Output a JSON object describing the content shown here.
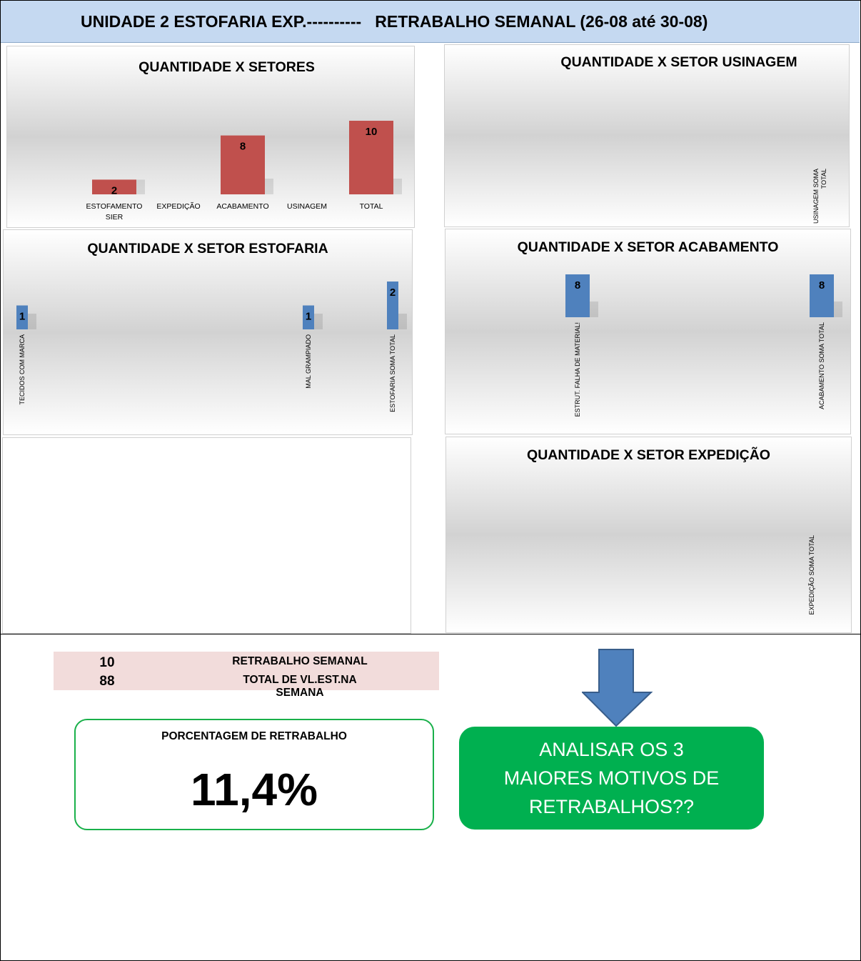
{
  "header": {
    "title": "UNIDADE 2 ESTOFARIA EXP.----------   RETRABALHO SEMANAL (26-08 até 30-08)"
  },
  "colors": {
    "red_bar": "#c0504d",
    "blue_bar": "#4f81bd",
    "header_bg": "#c5d9f1",
    "summary_bg": "#f2dcdb",
    "accent_green": "#00b050"
  },
  "chart_data": [
    {
      "id": "setores",
      "type": "bar",
      "title": "QUANTIDADE X SETORES",
      "categories": [
        "ESTOFAMENTO SIER",
        "EXPEDIÇÃO",
        "ACABAMENTO",
        "USINAGEM",
        "TOTAL"
      ],
      "values": [
        2,
        null,
        8,
        null,
        10
      ],
      "ylim": [
        0,
        20
      ],
      "grid": false,
      "legend": "none"
    },
    {
      "id": "usinagem",
      "type": "bar",
      "title": "QUANTIDADE X SETOR USINAGEM",
      "categories": [
        "USINAGEM SOMA TOTAL"
      ],
      "values": [
        null
      ],
      "grid": false,
      "legend": "none"
    },
    {
      "id": "estofaria",
      "type": "bar",
      "title": "QUANTIDADE X SETOR ESTOFARIA",
      "categories": [
        "TECIDOS COM MARCA",
        "MAL GRAMPIADO",
        "ESTOFARIA SOMA TOTAL"
      ],
      "values": [
        1,
        1,
        2
      ],
      "ylim": [
        0,
        2
      ],
      "grid": false,
      "legend": "none"
    },
    {
      "id": "acabamento",
      "type": "bar",
      "title": "QUANTIDADE X SETOR ACABAMENTO",
      "categories": [
        "ESTRUT. FALHA DE MATERIAL!",
        "ACABAMENTO SOMA TOTAL"
      ],
      "values": [
        8,
        8
      ],
      "ylim": [
        0,
        8
      ],
      "grid": false,
      "legend": "none"
    },
    {
      "id": "expedicao",
      "type": "bar",
      "title": "QUANTIDADE X SETOR EXPEDIÇÃO",
      "categories": [
        "EXPEDIÇÃO SOMA TOTAL"
      ],
      "values": [
        null
      ],
      "grid": false,
      "legend": "none"
    }
  ],
  "summary": {
    "rows": [
      {
        "value": "10",
        "label": "RETRABALHO SEMANAL"
      },
      {
        "value": "88",
        "label": "TOTAL DE VL.EST.NA SEMANA"
      }
    ],
    "percentage_title": "PORCENTAGEM DE RETRABALHO",
    "percentage_value": "11,4%"
  },
  "callout": {
    "text": "ANALISAR OS 3 MAIORES MOTIVOS DE RETRABALHOS??"
  }
}
